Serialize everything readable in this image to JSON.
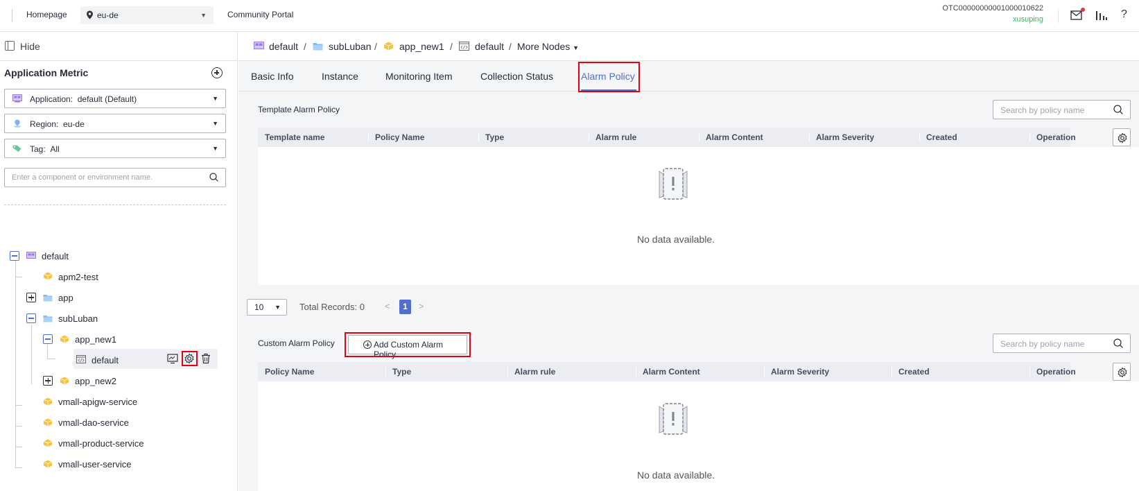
{
  "topbar": {
    "homepage": "Homepage",
    "region": "eu-de",
    "community": "Community Portal",
    "account": "OTC00000000001000010622",
    "user": "xusuping",
    "help": "?"
  },
  "left": {
    "hide_label": "Hide",
    "title": "Application Metric",
    "application_label": "Application:",
    "application_value": "default (Default)",
    "region_label": "Region:",
    "region_value": "eu-de",
    "tag_label": "Tag:",
    "tag_value": "All",
    "search_placeholder": "Enter a component or environment name.",
    "tree": {
      "root": "default",
      "n1": "apm2-test",
      "n2": "app",
      "n3": "subLuban",
      "n4": "app_new1",
      "n5": "default",
      "n6": "app_new2",
      "n7": "vmall-apigw-service",
      "n8": "vmall-dao-service",
      "n9": "vmall-product-service",
      "n10": "vmall-user-service"
    }
  },
  "breadcrumb": {
    "items": [
      "default",
      "subLuban",
      "app_new1",
      "default",
      "More Nodes"
    ],
    "sep": "/"
  },
  "tabs": [
    "Basic Info",
    "Instance",
    "Monitoring Item",
    "Collection Status",
    "Alarm Policy"
  ],
  "template_section": {
    "title": "Template Alarm Policy",
    "search_placeholder": "Search by policy name",
    "columns": [
      "Template name",
      "Policy Name",
      "Type",
      "Alarm rule",
      "Alarm Content",
      "Alarm Severity",
      "Created",
      "Operation"
    ],
    "empty": "No data available."
  },
  "pager": {
    "size": "10",
    "total": "Total Records: 0",
    "prev": "<",
    "page": "1",
    "next": ">"
  },
  "custom_section": {
    "title": "Custom Alarm Policy",
    "add_button": "Add Custom Alarm Policy",
    "search_placeholder": "Search by policy name",
    "columns": [
      "Policy Name",
      "Type",
      "Alarm rule",
      "Alarm Content",
      "Alarm Severity",
      "Created",
      "Operation"
    ],
    "empty": "No data available."
  },
  "colors": {
    "accent": "#526ecc",
    "highlight": "#e4000f",
    "user": "#29c34e"
  }
}
